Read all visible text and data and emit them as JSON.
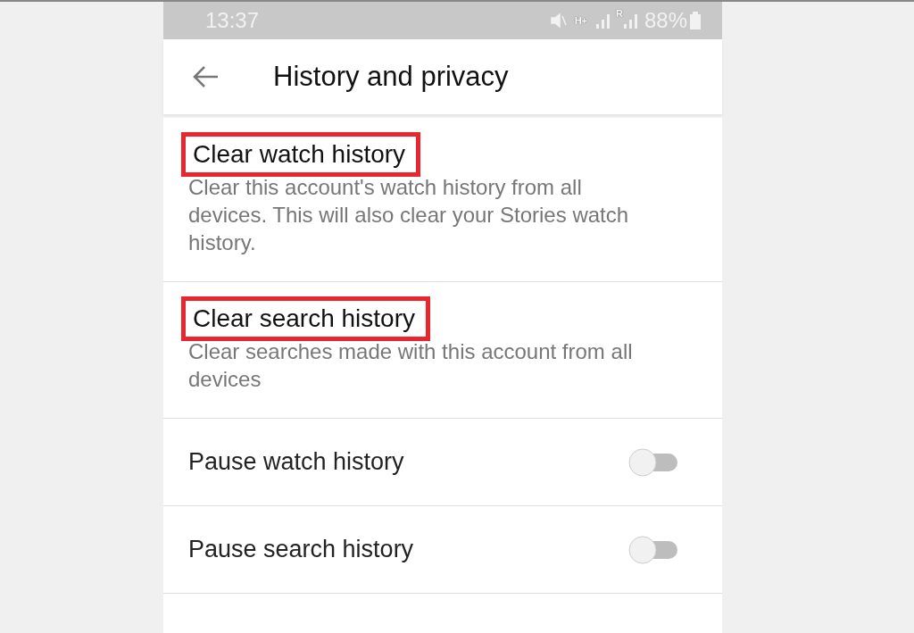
{
  "status_bar": {
    "time": "13:37",
    "network_label": "H+",
    "roaming_label": "R",
    "battery": "88%"
  },
  "header": {
    "title": "History and privacy"
  },
  "actions": [
    {
      "title": "Clear watch history",
      "highlighted": true,
      "description": "Clear this account's watch history from all devices. This will also clear your Stories watch history."
    },
    {
      "title": "Clear search history",
      "highlighted": true,
      "description": "Clear searches made with this account from all devices"
    }
  ],
  "toggles": [
    {
      "label": "Pause watch history",
      "on": false
    },
    {
      "label": "Pause search history",
      "on": false
    }
  ]
}
